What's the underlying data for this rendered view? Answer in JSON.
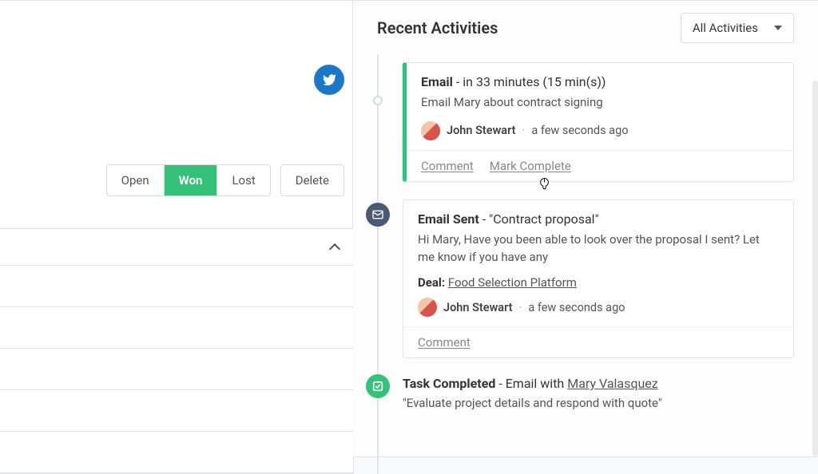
{
  "left": {
    "status_options": [
      "Open",
      "Won",
      "Lost"
    ],
    "active_status_index": 1,
    "delete_label": "Delete"
  },
  "right": {
    "heading": "Recent Activities",
    "filter_label": "All Activities"
  },
  "activities": [
    {
      "title_strong": "Email",
      "title_rest": " - in 33 minutes (15 min(s))",
      "subtitle": "Email Mary about contract signing",
      "author": "John Stewart",
      "time": "a few seconds ago",
      "actions": {
        "comment": "Comment",
        "complete": "Mark Complete"
      }
    },
    {
      "title_strong": "Email Sent",
      "title_rest": " - \"Contract proposal\"",
      "body": "Hi Mary, Have you been able to look over the proposal I sent? Let me know if you have any",
      "deal_label": "Deal:",
      "deal_name": "Food Selection Platform",
      "author": "John Stewart",
      "time": "a few seconds ago",
      "actions": {
        "comment": "Comment"
      }
    },
    {
      "title_strong": "Task Completed",
      "title_mid": " - Email with ",
      "link_name": "Mary Valasquez",
      "quote": "\"Evaluate project details and respond with quote\""
    }
  ]
}
